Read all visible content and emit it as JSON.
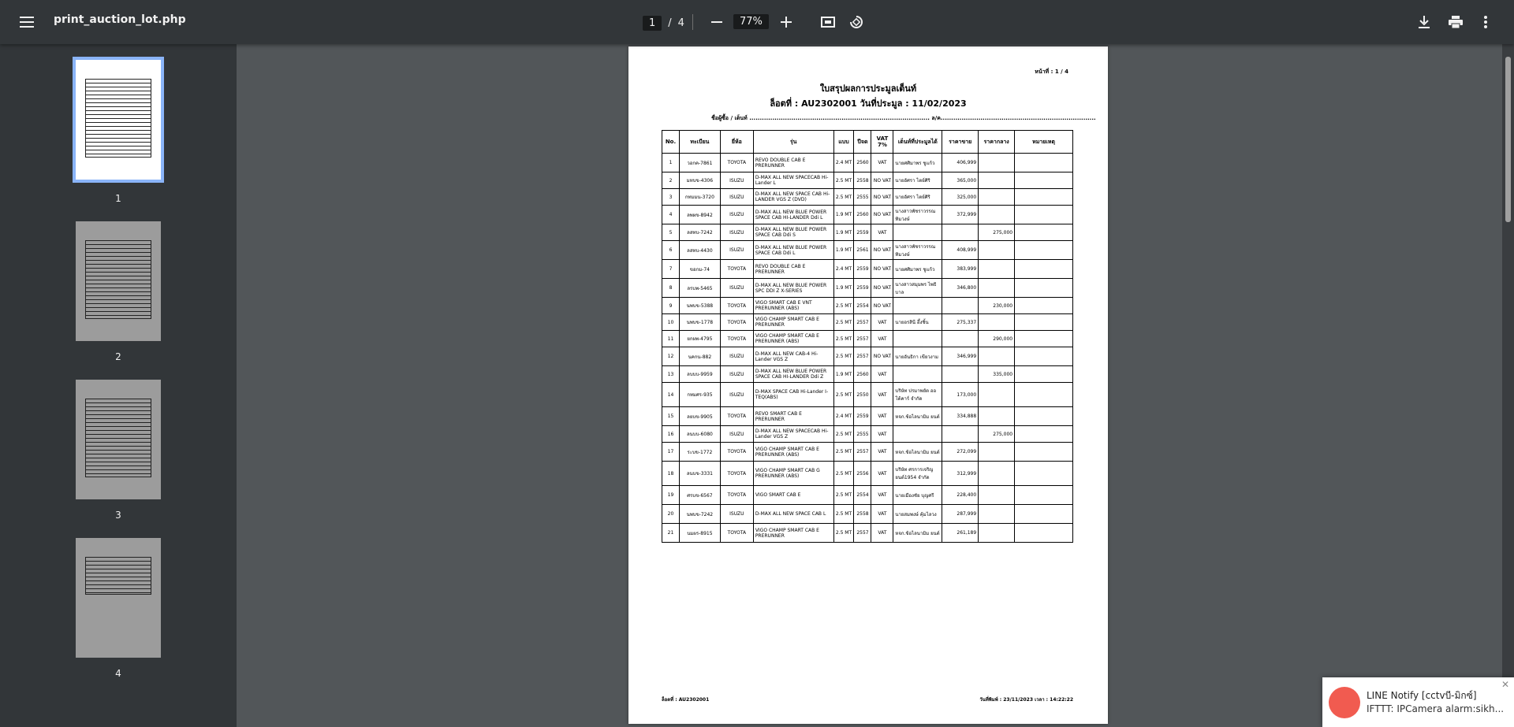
{
  "toolbar": {
    "title": "print_auction_lot.php",
    "page_current": "1",
    "page_sep": "/",
    "page_total": "4",
    "zoom": "77%"
  },
  "sidebar": {
    "thumbs": [
      {
        "label": "1"
      },
      {
        "label": "2"
      },
      {
        "label": "3"
      },
      {
        "label": "4"
      }
    ]
  },
  "doc": {
    "page_no": "หน้าที่ : 1 / 4",
    "title": "ใบสรุปผลการประมูลเต็นท์",
    "subtitle": "ล็อตที่ : AU2302001 วันที่ประมูล : 11/02/2023",
    "buyer_line": "ชื่อผู้ซื้อ / เต็นท์ ...................................................................................... ล/ค..........................................................................",
    "headers": [
      "No.",
      "ทะเบียน",
      "ยี่ห้อ",
      "รุ่น",
      "แบบ",
      "ปีจด",
      "VAT 7%",
      "เต็นท์ที่ประมูลได้",
      "ราคาขาย",
      "ราคากลาง",
      "หมายเหตุ"
    ],
    "rows": [
      [
        "1",
        "วอกค-7861",
        "TOYOTA",
        "REVO DOUBLE CAB E PRERUNNER",
        "2.4 MT",
        "2560",
        "VAT",
        "นายศศิมาพร ชูแก้ว",
        "406,999",
        "",
        ""
      ],
      [
        "2",
        "มทบข-4306",
        "ISUZU",
        "D-MAX ALL NEW SPACECAB Hi-Lander L",
        "2.5 MT",
        "2558",
        "NO VAT",
        "นายอัศรา ไตย์ศิริ",
        "365,000",
        "",
        ""
      ],
      [
        "3",
        "กทมมน-3720",
        "ISUZU",
        "D-MAX ALL NEW SPACE CAB Hi-LANDER VGS Z (DVD)",
        "2.5 MT",
        "2555",
        "NO VAT",
        "นายอัศรา ไตย์ศิริ",
        "325,000",
        "",
        ""
      ],
      [
        "4",
        "ลพผข-8942",
        "ISUZU",
        "D-MAX ALL NEW BLUE POWER SPACE CAB HI-LANDER Ddi L",
        "1.9 MT",
        "2560",
        "NO VAT",
        "นางสาวพัชราวรรณ ทิมวงษ์",
        "372,999",
        "",
        ""
      ],
      [
        "5",
        "ลสทบ-7242",
        "ISUZU",
        "D-MAX ALL NEW BLUE POWER SPACE CAB Ddi S",
        "1.9 MT",
        "2559",
        "VAT",
        "",
        "",
        "275,000",
        ""
      ],
      [
        "6",
        "ลสทบ-4430",
        "ISUZU",
        "D-MAX ALL NEW BLUE POWER SPACE CAB Ddi L",
        "1.9 MT",
        "2561",
        "NO VAT",
        "นางสาวพัชราวรรณ ทิมวงษ์",
        "408,999",
        "",
        ""
      ],
      [
        "7",
        "ขอกม-74",
        "TOYOTA",
        "REVO DOUBLE CAB E PRERUNNER",
        "2.4 MT",
        "2559",
        "NO VAT",
        "นายศศิมาพร ชูแก้ว",
        "383,999",
        "",
        ""
      ],
      [
        "8",
        "ลรบพ-5465",
        "ISUZU",
        "D-MAX ALL NEW BLUE POWER SPC DDI Z X-SERIES",
        "1.9 MT",
        "2559",
        "NO VAT",
        "นางสาวสมุมพร ไพธิบาล",
        "346,800",
        "",
        ""
      ],
      [
        "9",
        "นพบข-5388",
        "TOYOTA",
        "VIGO SMART CAB E VNT PRERUNNER (ABS)",
        "2.5 MT",
        "2554",
        "NO VAT",
        "",
        "",
        "230,000",
        ""
      ],
      [
        "10",
        "นพบข-1778",
        "TOYOTA",
        "VIGO CHAMP SMART CAB E PRERUNNER",
        "2.5 MT",
        "2557",
        "VAT",
        "นายอรสินี อึ้งชิ้น",
        "275,337",
        "",
        ""
      ],
      [
        "11",
        "ยกผพ-4795",
        "TOYOTA",
        "VIGO CHAMP SMART CAB E PRERUNNER (ABS)",
        "2.5 MT",
        "2557",
        "VAT",
        "",
        "",
        "290,000",
        ""
      ],
      [
        "12",
        "นคกน-882",
        "ISUZU",
        "D-MAX ALL NEW CAB-4 Hi-Lander VGS Z",
        "2.5 MT",
        "2557",
        "NO VAT",
        "นายอันธิกา เขียวงาม",
        "346,999",
        "",
        ""
      ],
      [
        "13",
        "ลบบบ-9959",
        "ISUZU",
        "D-MAX ALL NEW BLUE POWER SPACE CAB HI-LANDER Ddi Z",
        "1.9 MT",
        "2560",
        "VAT",
        "",
        "",
        "335,000",
        ""
      ],
      [
        "14",
        "กทมศร-935",
        "ISUZU",
        "D-MAX SPACE CAB Hi-Lander I-TEQ(ABS)",
        "2.5 MT",
        "2550",
        "VAT",
        "บริษัท ปรมาพยัต ออโต้คาร์ จำกัด",
        "173,000",
        "",
        ""
      ],
      [
        "15",
        "ลยบข-9905",
        "TOYOTA",
        "REVO SMART CAB E PRERUNNER",
        "2.4 MT",
        "2559",
        "VAT",
        "หจก.ช้อไลนามิม ยนต์",
        "334,888",
        "",
        ""
      ],
      [
        "16",
        "ลนบบ-6080",
        "ISUZU",
        "D-MAX ALL NEW SPACECAB Hi-Lander VGS Z",
        "2.5 MT",
        "2555",
        "VAT",
        "",
        "",
        "275,000",
        ""
      ],
      [
        "17",
        "ระบข-1772",
        "TOYOTA",
        "VIGO CHAMP SMART CAB E PRERUNNER (ABS)",
        "2.5 MT",
        "2557",
        "VAT",
        "หจก.ช้อไลนามิม ยนต์",
        "272,099",
        "",
        ""
      ],
      [
        "18",
        "ลนบข-3331",
        "TOYOTA",
        "VIGO CHAMP SMART CAB G PRERUNNER (ABS)",
        "2.5 MT",
        "2556",
        "VAT",
        "บริษัท ศรการเจริญยนต์1954 จำกัด",
        "312,999",
        "",
        ""
      ],
      [
        "19",
        "ศรบข-6567",
        "TOYOTA",
        "VIGO SMART CAB E",
        "2.5 MT",
        "2554",
        "VAT",
        "นายเมืองชัย บุญศรี",
        "228,400",
        "",
        ""
      ],
      [
        "20",
        "นพบข-7242",
        "ISUZU",
        "D-MAX ALL NEW SPACE CAB L",
        "2.5 MT",
        "2558",
        "VAT",
        "นายสมพงษ์ คุ้มไลวง",
        "287,999",
        "",
        ""
      ],
      [
        "21",
        "นมผร-8915",
        "TOYOTA",
        "VIGO CHAMP SMART CAB E PRERUNNER",
        "2.5 MT",
        "2557",
        "VAT",
        "หจก.ช้อไลนามิม ยนต์",
        "261,189",
        "",
        ""
      ]
    ],
    "footer_left": "ล็อตที่ : AU2302001",
    "footer_right": "วันที่พิมพ์ : 23/11/2023 เวลา : 14:22:22"
  },
  "notification": {
    "title": "LINE Notify [cctvบี-มิกซ์]",
    "body": "IFTTT: IPCamera alarm:sikh..."
  }
}
